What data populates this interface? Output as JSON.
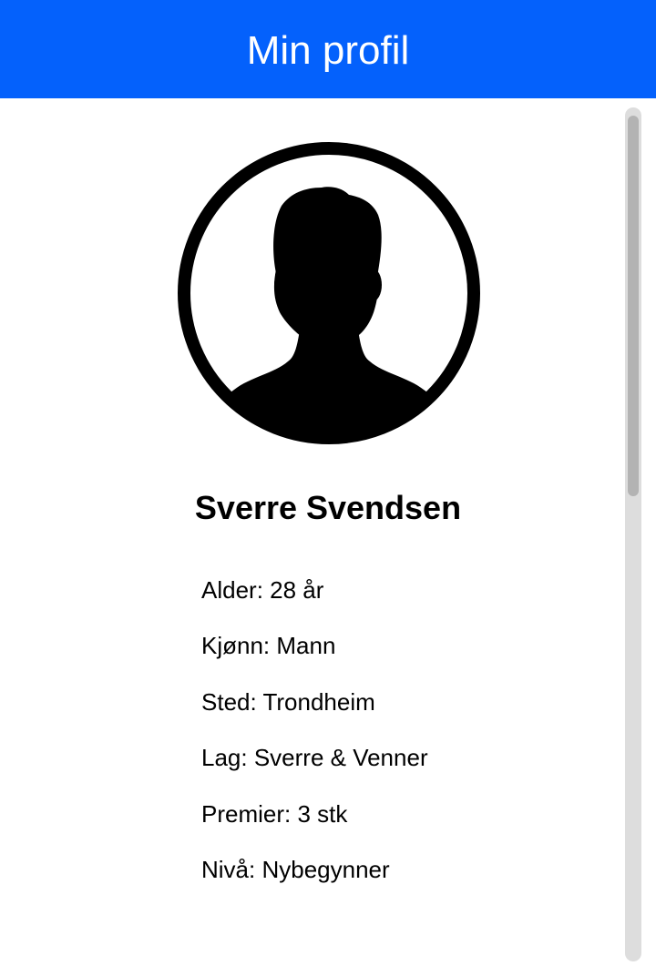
{
  "header": {
    "title": "Min profil",
    "background_color": "#0461fc"
  },
  "profile": {
    "avatar_icon": "person-silhouette-icon",
    "name": "Sverre Svendsen",
    "details": [
      "Alder: 28 år",
      "Kjønn: Mann",
      "Sted: Trondheim",
      "Lag: Sverre & Venner",
      "Premier: 3 stk",
      "Nivå: Nybegynner"
    ]
  },
  "scrollbar": {
    "track_color": "#dddddd",
    "thumb_color": "#b3b3b3"
  }
}
